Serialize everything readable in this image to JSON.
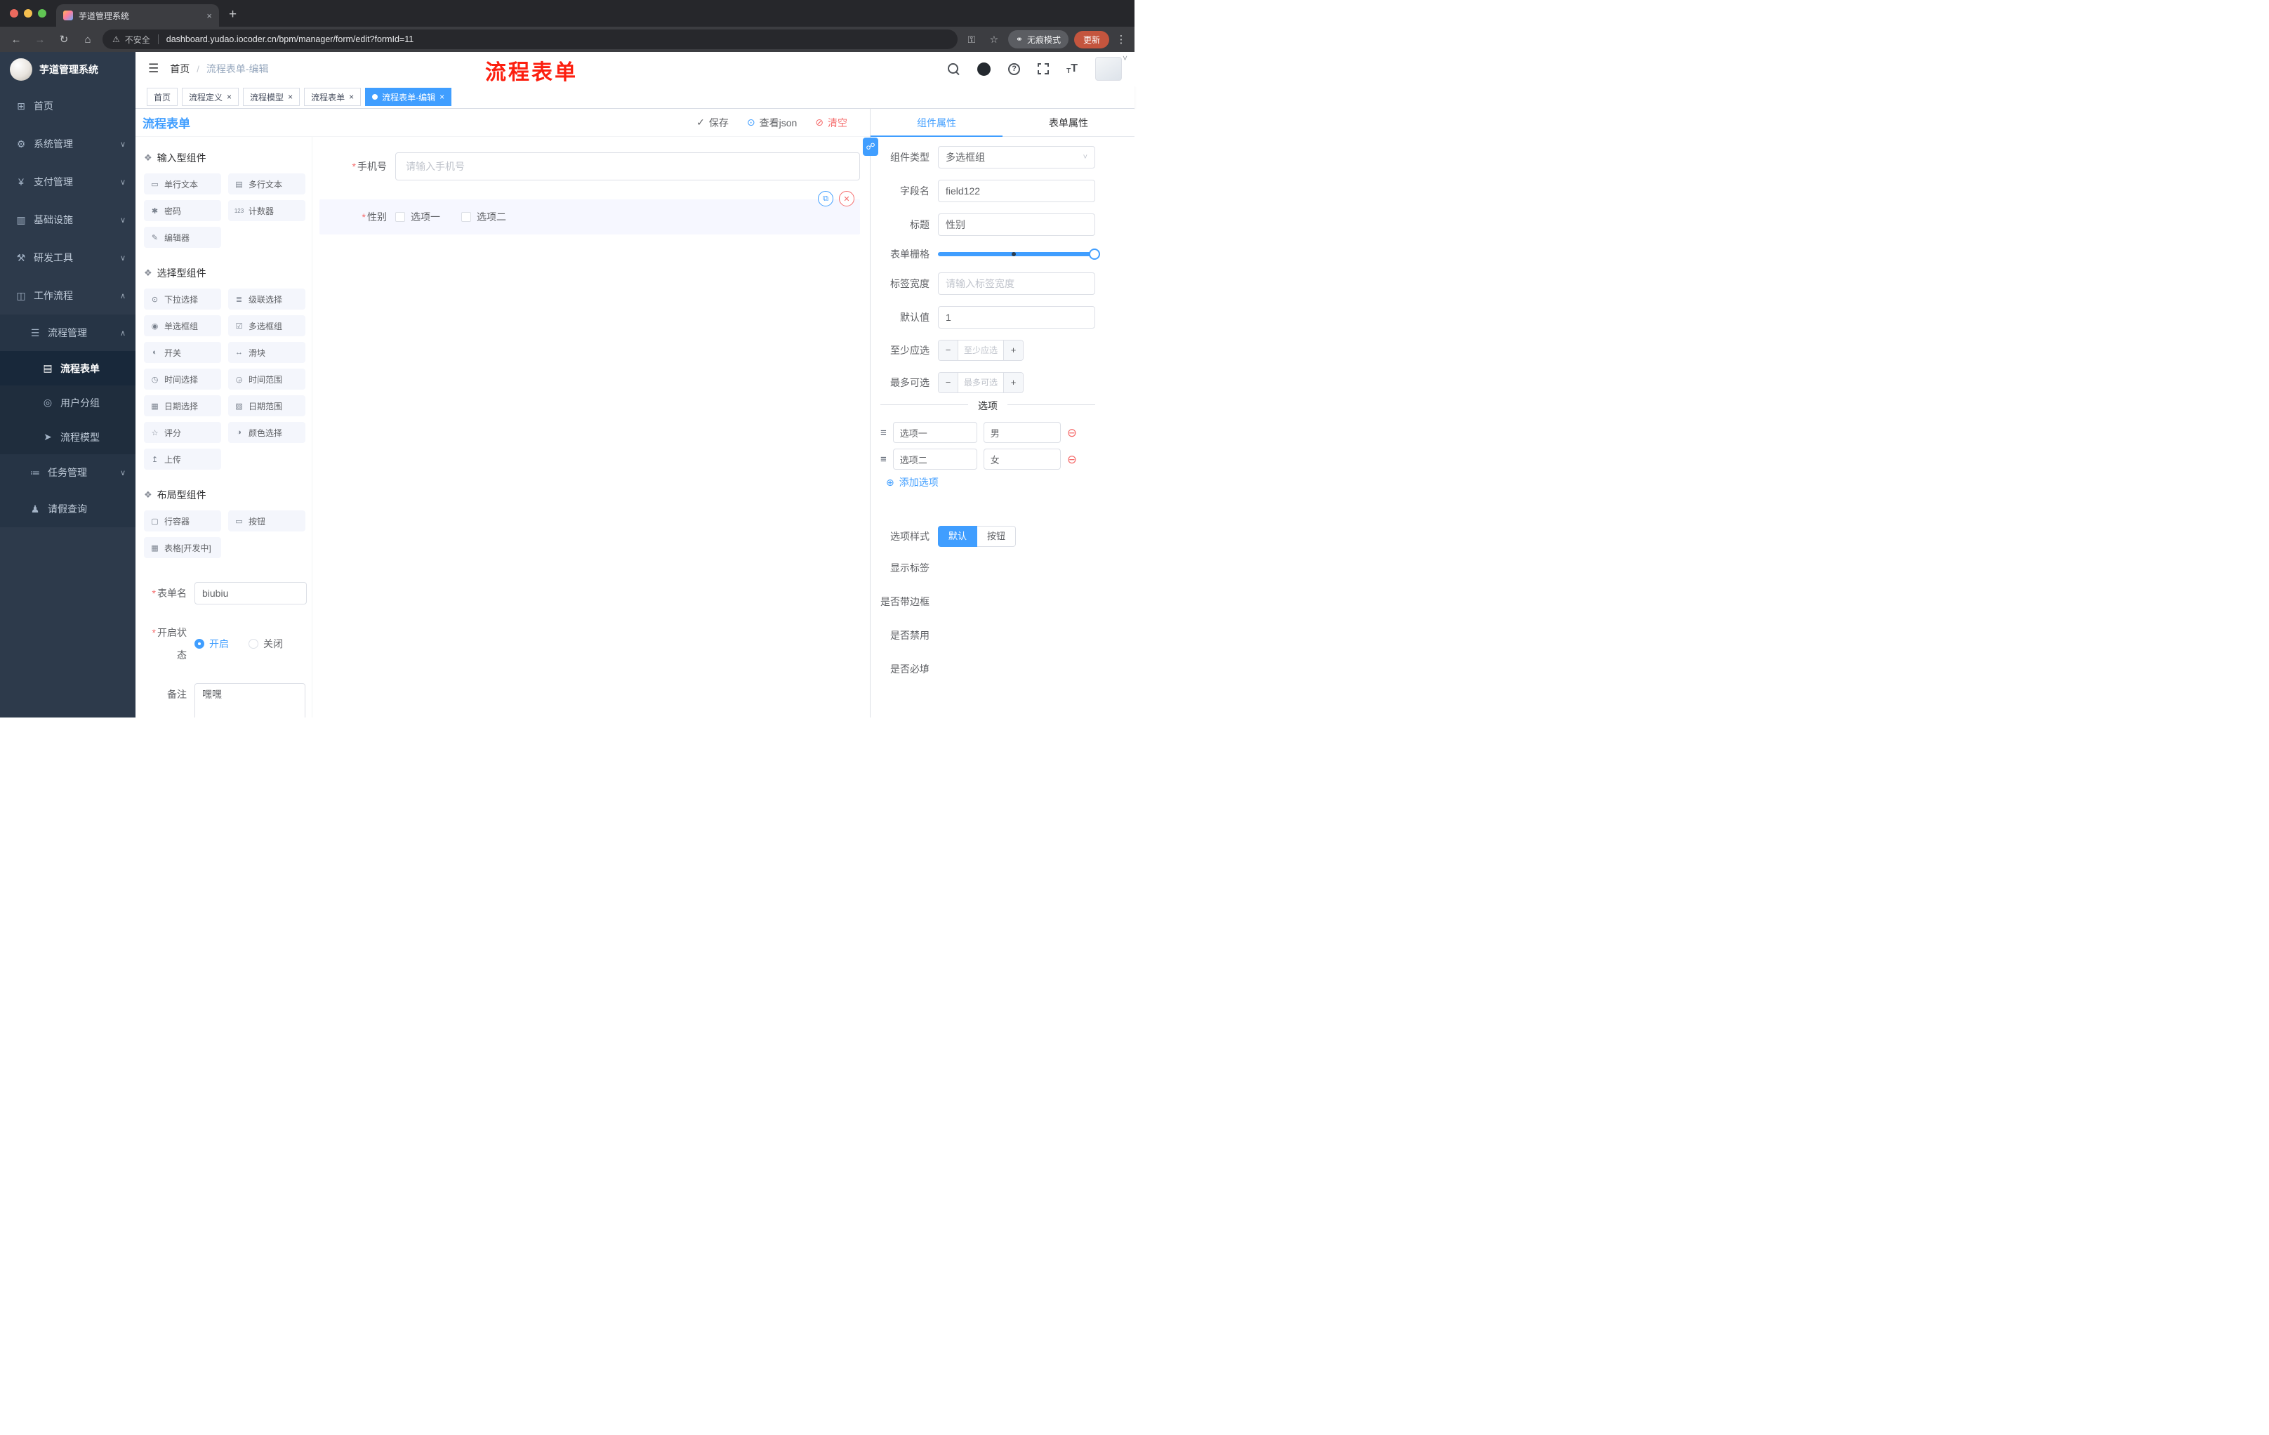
{
  "colors": {
    "accent": "#409eff",
    "danger": "#f56c6c",
    "annotation_red": "#fc1f0f",
    "update_button": "#c4553e",
    "sidebar_bg": "#2d3a4b"
  },
  "icons": {
    "back": "←",
    "forward": "→",
    "reload": "↻",
    "home": "⌂",
    "warning": "⚠",
    "key": "⚿",
    "star": "☆",
    "glasses": "⚭",
    "more": "⋮",
    "chevron_down": "˅",
    "hamburger": "☰",
    "question": "?",
    "font_big": "T",
    "font_small": "T",
    "check": "✓",
    "eye": "⊙",
    "trash": "⊘",
    "copy": "⧉",
    "delete": "✕",
    "link": "☍",
    "minus": "−",
    "plus": "+",
    "add_circle": "⊕",
    "remove_circle": "⊖",
    "drag": "≡",
    "close": "×",
    "newtab": "+",
    "group": "❖",
    "required": "*",
    "crumb_sep": "/"
  },
  "browser": {
    "tab_title": "芋道管理系统",
    "security_label": "不安全",
    "url": "dashboard.yudao.iocoder.cn/bpm/manager/form/edit?formId=11",
    "incognito_label": "无痕模式",
    "update_label": "更新"
  },
  "sidebar": {
    "app_title": "芋道管理系统",
    "menu": [
      {
        "icon": "⊞",
        "label": "首页",
        "chevron": ""
      },
      {
        "icon": "⚙",
        "label": "系统管理",
        "chevron": "∨"
      },
      {
        "icon": "¥",
        "label": "支付管理",
        "chevron": "∨"
      },
      {
        "icon": "▥",
        "label": "基础设施",
        "chevron": "∨"
      },
      {
        "icon": "⚒",
        "label": "研发工具",
        "chevron": "∨"
      },
      {
        "icon": "◫",
        "label": "工作流程",
        "chevron": "∧"
      }
    ],
    "submenu": [
      {
        "icon": "☰",
        "label": "流程管理",
        "chevron": "∧"
      },
      {
        "icon": "▤",
        "label": "流程表单"
      },
      {
        "icon": "◎",
        "label": "用户分组"
      },
      {
        "icon": "➤",
        "label": "流程模型"
      },
      {
        "icon": "≔",
        "label": "任务管理",
        "chevron": "∨"
      },
      {
        "icon": "♟",
        "label": "请假查询"
      }
    ]
  },
  "header": {
    "breadcrumb_home": "首页",
    "breadcrumb_current": "流程表单-编辑",
    "annotation": "流程表单"
  },
  "tags": [
    {
      "label": "首页"
    },
    {
      "label": "流程定义"
    },
    {
      "label": "流程模型"
    },
    {
      "label": "流程表单"
    },
    {
      "label": "流程表单-编辑"
    }
  ],
  "designer": {
    "title": "流程表单",
    "actions": {
      "save": "保存",
      "view_json": "查看json",
      "clear": "清空"
    },
    "groups": [
      {
        "title": "输入型组件",
        "items": [
          {
            "icon": "▭",
            "label": "单行文本"
          },
          {
            "icon": "▤",
            "label": "多行文本"
          },
          {
            "icon": "✱",
            "label": "密码"
          },
          {
            "icon": "123",
            "label": "计数器"
          },
          {
            "icon": "✎",
            "label": "编辑器"
          }
        ]
      },
      {
        "title": "选择型组件",
        "items": [
          {
            "icon": "⊙",
            "label": "下拉选择"
          },
          {
            "icon": "≣",
            "label": "级联选择"
          },
          {
            "icon": "◉",
            "label": "单选框组"
          },
          {
            "icon": "☑",
            "label": "多选框组"
          },
          {
            "icon": "◐",
            "label": "开关"
          },
          {
            "icon": "↔",
            "label": "滑块"
          },
          {
            "icon": "◷",
            "label": "时间选择"
          },
          {
            "icon": "◶",
            "label": "时间范围"
          },
          {
            "icon": "▦",
            "label": "日期选择"
          },
          {
            "icon": "▧",
            "label": "日期范围"
          },
          {
            "icon": "☆",
            "label": "评分"
          },
          {
            "icon": "◑",
            "label": "颜色选择"
          },
          {
            "icon": "↥",
            "label": "上传"
          }
        ]
      },
      {
        "title": "布局型组件",
        "items": [
          {
            "icon": "▢",
            "label": "行容器"
          },
          {
            "icon": "▭",
            "label": "按钮"
          },
          {
            "icon": "▦",
            "label": "表格[开发中]"
          }
        ]
      }
    ],
    "form_config": {
      "name_label": "表单名",
      "name_value": "biubiu",
      "status_label": "开启状态",
      "status_on": "开启",
      "status_off": "关闭",
      "remark_label": "备注",
      "remark_value": "嘿嘿"
    },
    "canvas": {
      "phone_label": "手机号",
      "phone_placeholder": "请输入手机号",
      "gender_label": "性别",
      "gender_option1": "选项一",
      "gender_option2": "选项二"
    }
  },
  "props": {
    "tab_component": "组件属性",
    "tab_form": "表单属性",
    "component_type_label": "组件类型",
    "component_type_value": "多选框组",
    "field_name_label": "字段名",
    "field_name_value": "field122",
    "title_label": "标题",
    "title_value": "性别",
    "grid_label": "表单栅格",
    "label_width_label": "标签宽度",
    "label_width_placeholder": "请输入标签宽度",
    "default_label": "默认值",
    "default_value": "1",
    "min_label": "至少应选",
    "min_placeholder": "至少应选",
    "max_label": "最多可选",
    "max_placeholder": "最多可选",
    "options_divider": "选项",
    "options": [
      {
        "label": "选项一",
        "value": "男"
      },
      {
        "label": "选项二",
        "value": "女"
      }
    ],
    "add_option": "添加选项",
    "option_style_label": "选项样式",
    "option_style_default": "默认",
    "option_style_button": "按钮",
    "toggles": [
      {
        "label": "显示标签",
        "on": true
      },
      {
        "label": "是否带边框",
        "on": false
      },
      {
        "label": "是否禁用",
        "on": false
      },
      {
        "label": "是否必填",
        "on": true
      }
    ]
  }
}
